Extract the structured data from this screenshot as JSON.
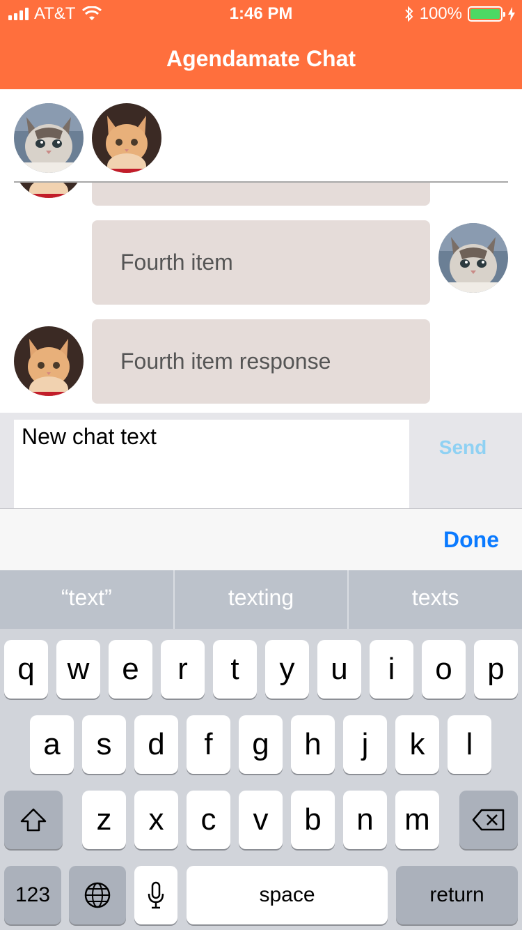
{
  "status_bar": {
    "carrier": "AT&T",
    "time": "1:46 PM",
    "battery": "100%",
    "battery_level": 1.0
  },
  "nav": {
    "title": "Agendamate Chat"
  },
  "colors": {
    "brand": "#ff6f3d",
    "bubble": "#e5dcd9",
    "send": "#8fd1f3",
    "done": "#0a7aff",
    "battery": "#4cd964"
  },
  "chat": {
    "messages": [
      {
        "text": "",
        "sender": "orange-kitten"
      },
      {
        "text": "Fourth item",
        "sender": "tabby-kitten"
      },
      {
        "text": "Fourth item response",
        "sender": "orange-kitten"
      }
    ]
  },
  "composer": {
    "value": "New chat text",
    "send_label": "Send"
  },
  "accessory": {
    "done_label": "Done"
  },
  "keyboard": {
    "suggestions": [
      "“text”",
      "texting",
      "texts"
    ],
    "row1": [
      "q",
      "w",
      "e",
      "r",
      "t",
      "y",
      "u",
      "i",
      "o",
      "p"
    ],
    "row2": [
      "a",
      "s",
      "d",
      "f",
      "g",
      "h",
      "j",
      "k",
      "l"
    ],
    "row3": [
      "z",
      "x",
      "c",
      "v",
      "b",
      "n",
      "m"
    ],
    "numbers_label": "123",
    "space_label": "space",
    "return_label": "return"
  }
}
